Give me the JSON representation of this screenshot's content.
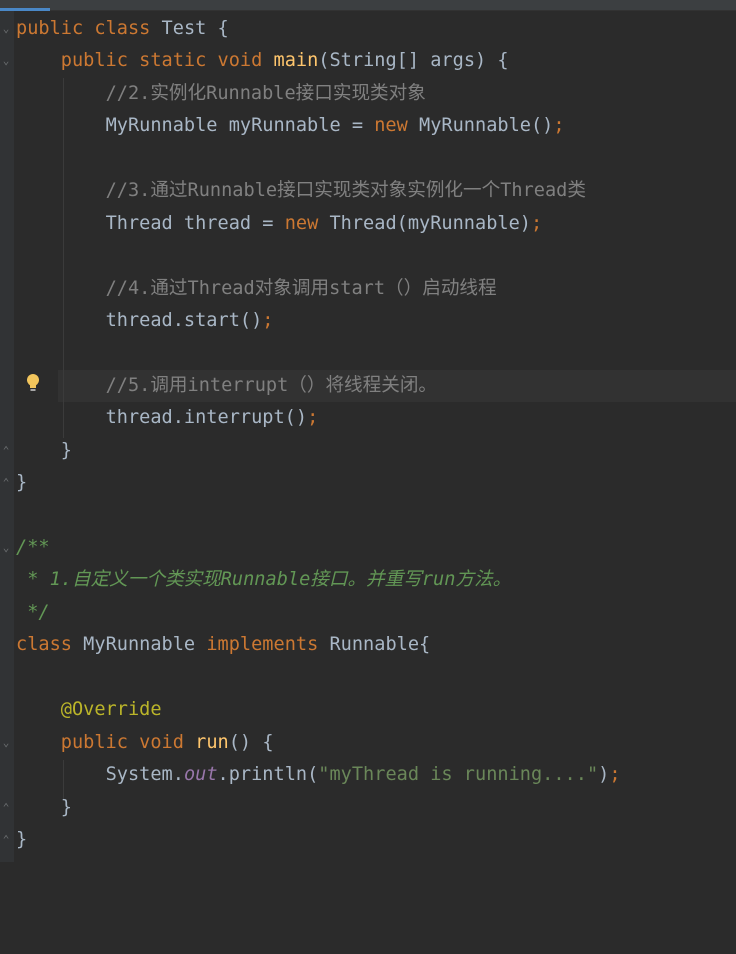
{
  "editor": {
    "language": "Java",
    "theme_colors": {
      "background": "#2b2b2b",
      "keyword": "#cc7832",
      "comment": "#808080",
      "doc_comment": "#629755",
      "string": "#6a8759",
      "annotation": "#bbb529",
      "method_decl": "#ffc66d",
      "static_field": "#9876aa",
      "default_text": "#a9b7c6"
    },
    "gutter_icons": [
      "fold-icon",
      "intention-bulb-icon"
    ]
  },
  "code": {
    "l1_kw1": "public",
    "l1_kw2": "class",
    "l1_rest": " Test {",
    "l2_kw1": "public",
    "l2_kw2": "static",
    "l2_kw3": "void",
    "l2_fn": "main",
    "l2_rest": "(String[] args) {",
    "l3_comment": "//2.实例化Runnable接口实现类对象",
    "l4_a": "MyRunnable myRunnable = ",
    "l4_kw": "new",
    "l4_b": " MyRunnable()",
    "l4_semi": ";",
    "l6_comment": "//3.通过Runnable接口实现类对象实例化一个Thread类",
    "l7_a": "Thread thread = ",
    "l7_kw": "new",
    "l7_b": " Thread(myRunnable)",
    "l7_semi": ";",
    "l9_comment": "//4.通过Thread对象调用start（）启动线程",
    "l10_a": "thread.start()",
    "l10_semi": ";",
    "l12_comment": "//5.调用interrupt（）将线程关闭。",
    "l13_a": "thread.interrupt()",
    "l13_semi": ";",
    "l14": "}",
    "l15": "}",
    "l17_doc": "/**",
    "l18_doc": " * 1.自定义一个类实现Runnable接口。并重写run方法。",
    "l19_doc": " */",
    "l20_kw1": "class",
    "l20_a": " MyRunnable ",
    "l20_kw2": "implements",
    "l20_b": " Runnable{",
    "l22_ann": "@Override",
    "l23_kw1": "public",
    "l23_kw2": "void",
    "l23_fn": "run",
    "l23_rest": "() {",
    "l24_a": "System.",
    "l24_field": "out",
    "l24_b": ".println(",
    "l24_str": "\"myThread is running....\"",
    "l24_c": ")",
    "l24_semi": ";",
    "l25": "}",
    "l26": "}"
  }
}
